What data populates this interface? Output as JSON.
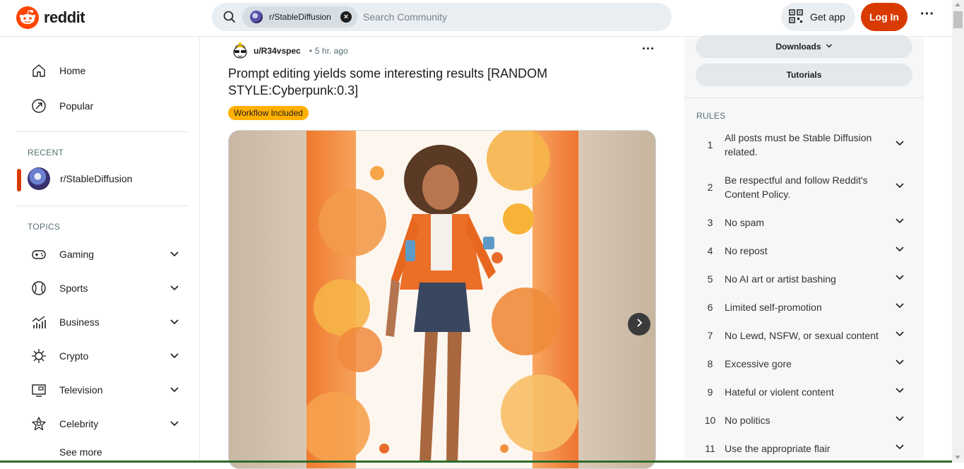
{
  "header": {
    "logo_text": "reddit",
    "search_chip_label": "r/StableDiffusion",
    "search_placeholder": "Search Community",
    "get_app_label": "Get app",
    "login_label": "Log In",
    "more_label": "···"
  },
  "sidebar": {
    "nav": [
      {
        "label": "Home",
        "icon": "home-icon"
      },
      {
        "label": "Popular",
        "icon": "popular-icon"
      }
    ],
    "recent_label": "RECENT",
    "recent_items": [
      {
        "label": "r/StableDiffusion"
      }
    ],
    "topics_label": "TOPICS",
    "topics": [
      {
        "label": "Gaming",
        "icon": "gamepad-icon"
      },
      {
        "label": "Sports",
        "icon": "ball-icon"
      },
      {
        "label": "Business",
        "icon": "chart-icon"
      },
      {
        "label": "Crypto",
        "icon": "crypto-icon"
      },
      {
        "label": "Television",
        "icon": "tv-icon"
      },
      {
        "label": "Celebrity",
        "icon": "star-icon"
      }
    ],
    "see_more_label": "See more"
  },
  "post": {
    "username": "u/R34vspec",
    "separator": "•",
    "time": "5 hr. ago",
    "title": "Prompt editing yields some interesting results [RANDOM STYLE:Cyberpunk:0.3]",
    "flair": "Workflow Included"
  },
  "right_sidebar": {
    "downloads_label": "Downloads",
    "tutorials_label": "Tutorials",
    "rules_label": "RULES",
    "rules": [
      {
        "num": "1",
        "text": "All posts must be Stable Diffusion related."
      },
      {
        "num": "2",
        "text": "Be respectful and follow Reddit's Content Policy."
      },
      {
        "num": "3",
        "text": "No spam"
      },
      {
        "num": "4",
        "text": "No repost"
      },
      {
        "num": "5",
        "text": "No AI art or artist bashing"
      },
      {
        "num": "6",
        "text": "Limited self-promotion"
      },
      {
        "num": "7",
        "text": "No Lewd, NSFW, or sexual content"
      },
      {
        "num": "8",
        "text": "Excessive gore"
      },
      {
        "num": "9",
        "text": "Hateful or violent content"
      },
      {
        "num": "10",
        "text": "No politics"
      },
      {
        "num": "11",
        "text": "Use the appropriate flair"
      }
    ]
  },
  "colors": {
    "brand": "#ff4500",
    "login": "#d93a00",
    "flair": "#ffb000"
  }
}
